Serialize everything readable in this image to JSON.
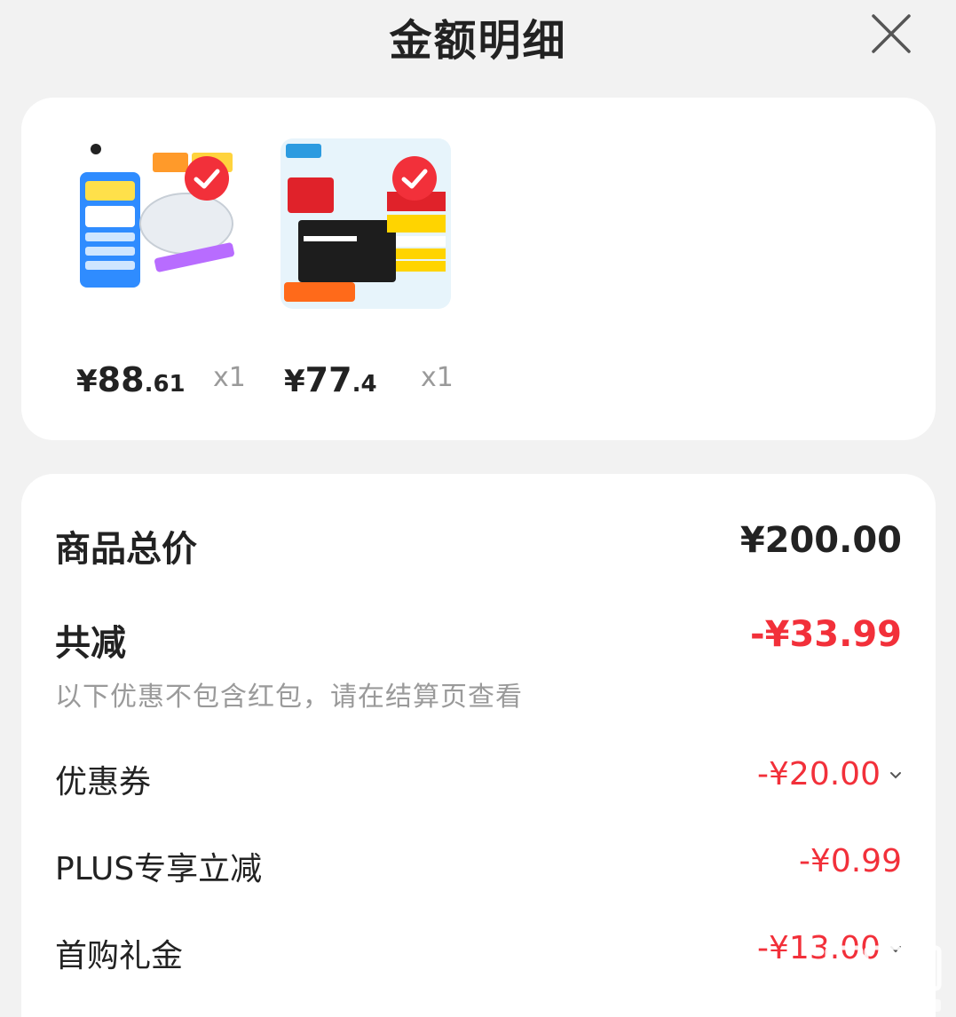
{
  "header": {
    "title": "金额明细",
    "close_icon": "close-icon"
  },
  "products": [
    {
      "price_currency": "¥",
      "price_int": "88",
      "price_dec": ".61",
      "qty": "x1"
    },
    {
      "price_currency": "¥",
      "price_int": "77",
      "price_dec": ".4",
      "qty": "x1"
    }
  ],
  "summary": {
    "total_label": "商品总价",
    "total_value": "¥200.00",
    "reduce_label": "共减",
    "reduce_value": "-¥33.99",
    "note": "以下优惠不包含红包，请在结算页查看",
    "items": [
      {
        "label": "优惠券",
        "value": "-¥20.00"
      },
      {
        "label": "PLUS专享立减",
        "value": "-¥0.99"
      },
      {
        "label": "首购礼金",
        "value": "-¥13.00"
      }
    ]
  },
  "colors": {
    "accent_red": "#f2303a",
    "background": "#f2f2f2",
    "card": "#ffffff"
  }
}
